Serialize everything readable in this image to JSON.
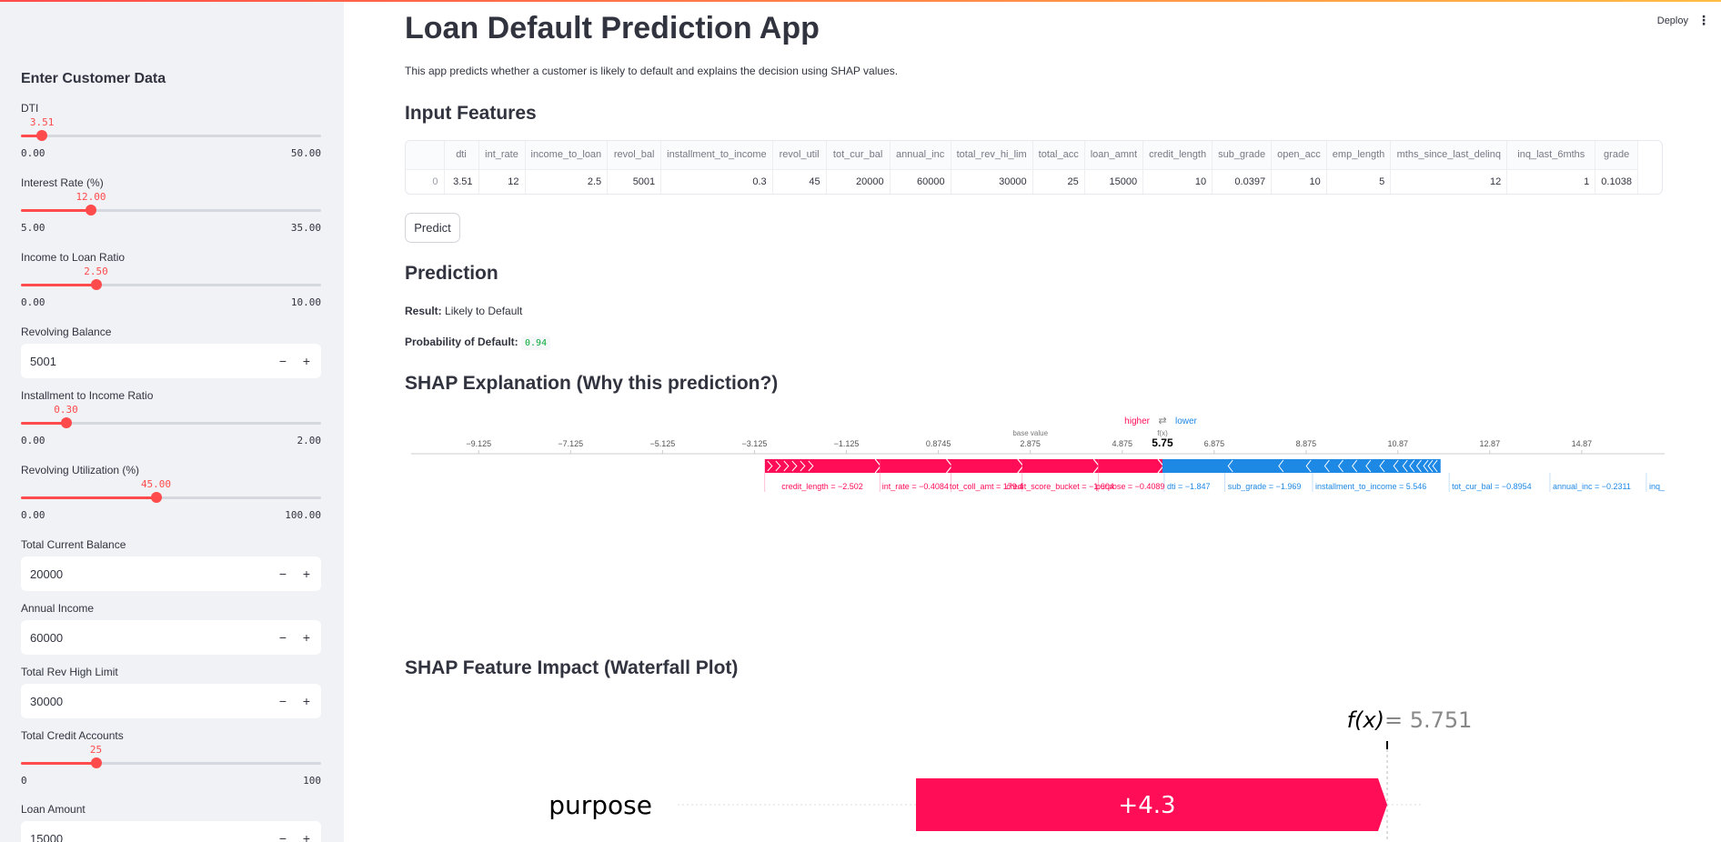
{
  "sidebar": {
    "title": "Enter Customer Data",
    "fields": [
      {
        "type": "slider",
        "label": "DTI",
        "value": 3.51,
        "value_text": "3.51",
        "min": 0,
        "max": 50,
        "min_text": "0.00",
        "max_text": "50.00"
      },
      {
        "type": "slider",
        "label": "Interest Rate (%)",
        "value": 12,
        "value_text": "12.00",
        "min": 5,
        "max": 35,
        "min_text": "5.00",
        "max_text": "35.00"
      },
      {
        "type": "slider",
        "label": "Income to Loan Ratio",
        "value": 2.5,
        "value_text": "2.50",
        "min": 0,
        "max": 10,
        "min_text": "0.00",
        "max_text": "10.00"
      },
      {
        "type": "number",
        "label": "Revolving Balance",
        "value": "5001"
      },
      {
        "type": "slider",
        "label": "Installment to Income Ratio",
        "value": 0.3,
        "value_text": "0.30",
        "min": 0,
        "max": 2,
        "min_text": "0.00",
        "max_text": "2.00"
      },
      {
        "type": "slider",
        "label": "Revolving Utilization (%)",
        "value": 45,
        "value_text": "45.00",
        "min": 0,
        "max": 100,
        "min_text": "0.00",
        "max_text": "100.00"
      },
      {
        "type": "number",
        "label": "Total Current Balance",
        "value": "20000"
      },
      {
        "type": "number",
        "label": "Annual Income",
        "value": "60000"
      },
      {
        "type": "number",
        "label": "Total Rev High Limit",
        "value": "30000"
      },
      {
        "type": "slider",
        "label": "Total Credit Accounts",
        "value": 25,
        "value_text": "25",
        "min": 0,
        "max": 100,
        "min_text": "0",
        "max_text": "100"
      },
      {
        "type": "number",
        "label": "Loan Amount",
        "value": "15000"
      }
    ],
    "minus": "−",
    "plus": "+"
  },
  "header": {
    "deploy": "Deploy",
    "menu": "⋮"
  },
  "main": {
    "title": "Loan Default Prediction App",
    "description": "This app predicts whether a customer is likely to default and explains the decision using SHAP values.",
    "input_heading": "Input Features",
    "table": {
      "columns": [
        "",
        "dti",
        "int_rate",
        "income_to_loan",
        "revol_bal",
        "installment_to_income",
        "revol_util",
        "tot_cur_bal",
        "annual_inc",
        "total_rev_hi_lim",
        "total_acc",
        "loan_amnt",
        "credit_length",
        "sub_grade",
        "open_acc",
        "emp_length",
        "mths_since_last_delinq",
        "inq_last_6mths",
        "grade"
      ],
      "rows": [
        [
          "0",
          "3.51",
          "12",
          "2.5",
          "5001",
          "0.3",
          "45",
          "20000",
          "60000",
          "30000",
          "25",
          "15000",
          "10",
          "0.0397",
          "10",
          "5",
          "12",
          "1",
          "0.1038"
        ]
      ]
    },
    "predict_button": "Predict",
    "prediction_heading": "Prediction",
    "result_label": "Result:",
    "result_value": "Likely to Default",
    "prob_label": "Probability of Default:",
    "prob_value": "0.94",
    "shap_heading": "SHAP Explanation (Why this prediction?)",
    "waterfall_heading": "SHAP Feature Impact (Waterfall Plot)"
  },
  "colors": {
    "accent": "#ff4b4b",
    "shap_pos": "#ff0d57",
    "shap_neg": "#1e88e5",
    "shap_pos_text": "#ff0d57",
    "shap_neg_text": "#1e88e5"
  },
  "force_plot": {
    "legend_higher": "higher",
    "legend_arrows": "⇄",
    "legend_lower": "lower",
    "base_label": "base value",
    "fx_label": "f(x)",
    "fx_value": "5.75",
    "axis_min": -10.0,
    "axis_max": 16.0,
    "ticks": [
      {
        "v": -9.125,
        "label": "−9.125"
      },
      {
        "v": -7.125,
        "label": "−7.125"
      },
      {
        "v": -5.125,
        "label": "−5.125"
      },
      {
        "v": -3.125,
        "label": "−3.125"
      },
      {
        "v": -1.125,
        "label": "−1.125"
      },
      {
        "v": 0.8745,
        "label": "0.8745"
      },
      {
        "v": 2.875,
        "label": "2.875"
      },
      {
        "v": 4.875,
        "label": "4.875"
      },
      {
        "v": 6.875,
        "label": "6.875"
      },
      {
        "v": 8.875,
        "label": "8.875"
      },
      {
        "v": 10.87,
        "label": "10.87"
      },
      {
        "v": 12.87,
        "label": "12.87"
      },
      {
        "v": 14.87,
        "label": "14.87"
      }
    ],
    "base_value": 2.875,
    "f_value": 5.75,
    "pos_start": -2.9,
    "pos_segments": [
      {
        "from": -2.9,
        "to": -0.4,
        "label": "credit_length = −2.502"
      },
      {
        "from": -0.4,
        "to": 1.15,
        "label": "int_rate = −0.4084"
      },
      {
        "from": 1.15,
        "to": 2.7,
        "label": "tot_coll_amt = 179.4"
      },
      {
        "from": 2.7,
        "to": 4.35,
        "label": "credit_score_bucket = −1.604"
      },
      {
        "from": 4.35,
        "to": 5.75,
        "label": "purpose = −0.4089"
      }
    ],
    "neg_end": 11.8,
    "neg_labels": [
      "dti = −1.847",
      "sub_grade = −1.969",
      "installment_to_income = 5.546",
      "tot_cur_bal = −0.8954",
      "annual_inc = −0.2311",
      "inq_"
    ]
  },
  "waterfall": {
    "fx_symbol": "f(x)",
    "fx_eq": " = 5.751",
    "feature": "purpose",
    "bar_label": "+4.3"
  }
}
